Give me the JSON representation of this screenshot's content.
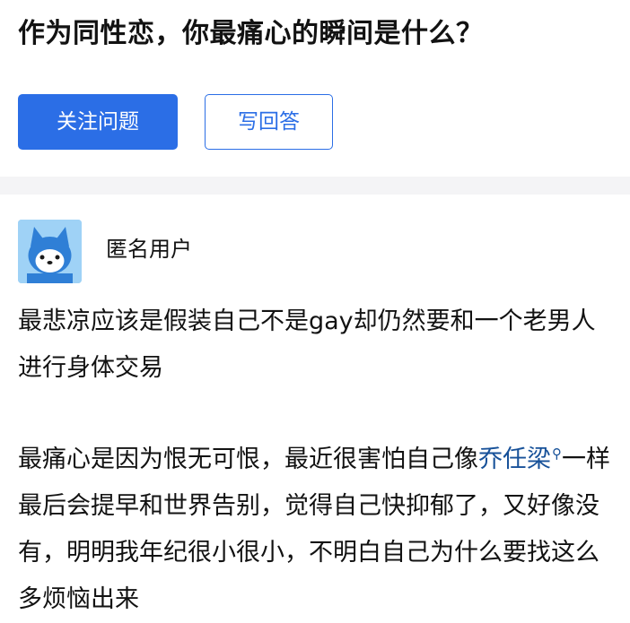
{
  "question": {
    "title": "作为同性恋，你最痛心的瞬间是什么？",
    "follow_label": "关注问题",
    "answer_label": "写回答"
  },
  "answer": {
    "author": "匿名用户",
    "avatar_icon": "anonymous-user-avatar",
    "paragraph1": "最悲凉应该是假装自己不是gay却仍然要和一个老男人进行身体交易",
    "paragraph2_before": "最痛心是因为恨无可恨，最近很害怕自己像",
    "link_text": "乔任梁",
    "search_icon": "search-icon",
    "paragraph2_after": "一样最后会提早和世界告别，觉得自己快抑郁了，又好像没有，明明我年纪很小很小，不明白自己为什么要找这么多烦恼出来"
  },
  "colors": {
    "accent": "#2b6ee6",
    "link": "#175199",
    "divider": "#f4f4f6",
    "text": "#121212"
  }
}
